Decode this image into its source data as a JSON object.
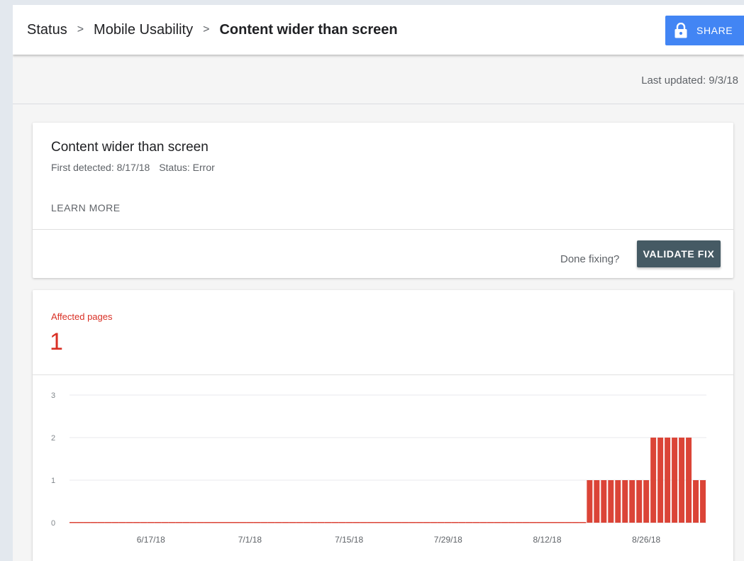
{
  "breadcrumb": {
    "items": [
      "Status",
      "Mobile Usability"
    ],
    "current": "Content wider than screen",
    "separator": ">"
  },
  "share_button": {
    "label": "SHARE",
    "icon": "lock-icon"
  },
  "last_updated": "Last updated: 9/3/18",
  "issue": {
    "title": "Content wider than screen",
    "first_detected": "First detected: 8/17/18",
    "status": "Status: Error",
    "learn_more": "LEARN MORE",
    "done_fixing": "Done fixing?",
    "validate_label": "VALIDATE FIX"
  },
  "affected": {
    "label": "Affected pages",
    "value": "1"
  },
  "colors": {
    "share_blue": "#4285f4",
    "validate_slate": "#455a64",
    "error_red": "#d93025",
    "bar_red": "#db4437"
  },
  "chart_data": {
    "type": "bar",
    "x_start": "6/6/18",
    "x_end": "9/2/18",
    "xtick_labels": [
      "6/17/18",
      "7/1/18",
      "7/15/18",
      "7/29/18",
      "8/12/18",
      "8/26/18"
    ],
    "ylim": [
      0,
      3
    ],
    "yticks": [
      0,
      1,
      2,
      3
    ],
    "grid": true,
    "values": [
      0,
      0,
      0,
      0,
      0,
      0,
      0,
      0,
      0,
      0,
      0,
      0,
      0,
      0,
      0,
      0,
      0,
      0,
      0,
      0,
      0,
      0,
      0,
      0,
      0,
      0,
      0,
      0,
      0,
      0,
      0,
      0,
      0,
      0,
      0,
      0,
      0,
      0,
      0,
      0,
      0,
      0,
      0,
      0,
      0,
      0,
      0,
      0,
      0,
      0,
      0,
      0,
      0,
      0,
      0,
      0,
      0,
      0,
      0,
      0,
      0,
      0,
      0,
      0,
      0,
      0,
      0,
      0,
      0,
      0,
      0,
      0,
      0,
      1,
      1,
      1,
      1,
      1,
      1,
      1,
      1,
      1,
      2,
      2,
      2,
      2,
      2,
      2,
      1,
      1
    ]
  }
}
